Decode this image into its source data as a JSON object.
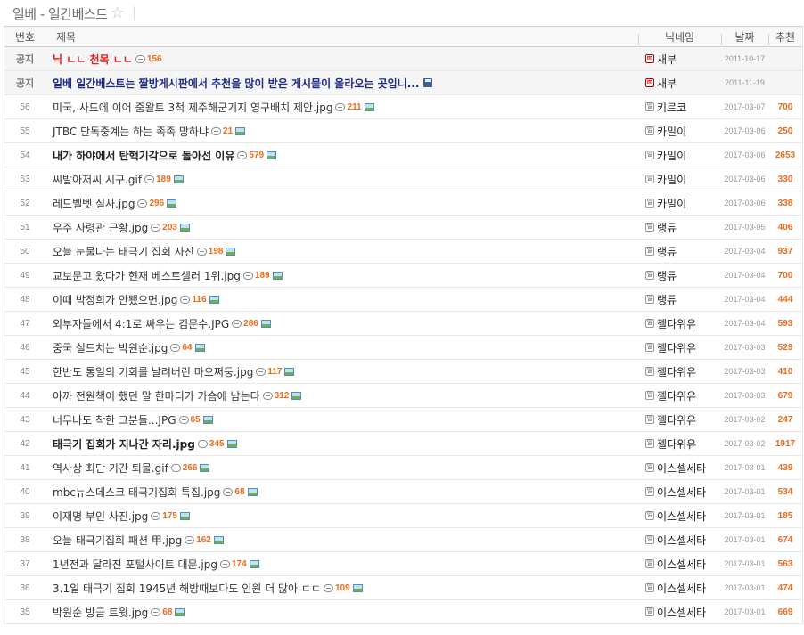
{
  "board": {
    "title": "일베 - 일간베스트",
    "star": "☆"
  },
  "header": {
    "no": "번호",
    "title": "제목",
    "nick": "닉네임",
    "date": "날짜",
    "rec": "추천"
  },
  "notices": [
    {
      "no": "공지",
      "title": "닉 ㄴㄴ 천목 ㄴㄴ",
      "comments": "156",
      "nick": "새부",
      "date": "2011-10-17",
      "rec": ""
    },
    {
      "no": "공지",
      "title": "일베 일간베스트는 짤방게시판에서 추천을 많이 받은 게시물이 올라오는 곳입니...",
      "comments": "",
      "nick": "새부",
      "date": "2011-11-19",
      "rec": ""
    }
  ],
  "rows": [
    {
      "no": "56",
      "title": "미국, 사드에 이어 줌왈트 3척 제주해군기지 영구배치 제안.jpg",
      "comments": "211",
      "nick": "키르코",
      "date": "2017-03-07",
      "rec": "700",
      "bold": false
    },
    {
      "no": "55",
      "title": "JTBC 단독중계는 하는 족족 망하냐",
      "comments": "21",
      "nick": "카밀이",
      "date": "2017-03-06",
      "rec": "250",
      "bold": false
    },
    {
      "no": "54",
      "title": "내가 하야에서 탄핵기각으로 돌아선 이유",
      "comments": "579",
      "nick": "카밀이",
      "date": "2017-03-06",
      "rec": "2653",
      "bold": true
    },
    {
      "no": "53",
      "title": "씨발아저씨 시구.gif",
      "comments": "189",
      "nick": "카밀이",
      "date": "2017-03-06",
      "rec": "330",
      "bold": false
    },
    {
      "no": "52",
      "title": "레드벨벳 실사.jpg",
      "comments": "296",
      "nick": "카밀이",
      "date": "2017-03-06",
      "rec": "338",
      "bold": false
    },
    {
      "no": "51",
      "title": "우주 사령관 근황.jpg",
      "comments": "203",
      "nick": "랭듀",
      "date": "2017-03-05",
      "rec": "406",
      "bold": false
    },
    {
      "no": "50",
      "title": "오늘 눈물나는 태극기 집회 사진",
      "comments": "198",
      "nick": "랭듀",
      "date": "2017-03-04",
      "rec": "937",
      "bold": false
    },
    {
      "no": "49",
      "title": "교보문고 왔다가 현재 베스트셀러 1위.jpg",
      "comments": "189",
      "nick": "랭듀",
      "date": "2017-03-04",
      "rec": "700",
      "bold": false
    },
    {
      "no": "48",
      "title": "이때 박정희가 안됐으면.jpg",
      "comments": "116",
      "nick": "랭듀",
      "date": "2017-03-04",
      "rec": "444",
      "bold": false
    },
    {
      "no": "47",
      "title": "외부자들에서 4:1로 싸우는 김문수.JPG",
      "comments": "286",
      "nick": "젤다위유",
      "date": "2017-03-04",
      "rec": "593",
      "bold": false
    },
    {
      "no": "46",
      "title": "중국 실드치는 박원순.jpg",
      "comments": "64",
      "nick": "젤다위유",
      "date": "2017-03-03",
      "rec": "529",
      "bold": false
    },
    {
      "no": "45",
      "title": "한반도 통일의 기회를 날려버린 마오쩌둥.jpg",
      "comments": "117",
      "nick": "젤다위유",
      "date": "2017-03-03",
      "rec": "410",
      "bold": false
    },
    {
      "no": "44",
      "title": "아까 전원책이 했던 말 한마디가 가슴에 남는다",
      "comments": "312",
      "nick": "젤다위유",
      "date": "2017-03-03",
      "rec": "679",
      "bold": false
    },
    {
      "no": "43",
      "title": "너무나도 착한 그분들...JPG",
      "comments": "65",
      "nick": "젤다위유",
      "date": "2017-03-02",
      "rec": "247",
      "bold": false
    },
    {
      "no": "42",
      "title": "태극기 집회가 지나간 자리.jpg",
      "comments": "345",
      "nick": "젤다위유",
      "date": "2017-03-02",
      "rec": "1917",
      "bold": true
    },
    {
      "no": "41",
      "title": "역사상 최단 기간 퇴물.gif",
      "comments": "266",
      "nick": "이스셀세타",
      "date": "2017-03-01",
      "rec": "439",
      "bold": false
    },
    {
      "no": "40",
      "title": "mbc뉴스데스크 태극기집회 특집.jpg",
      "comments": "68",
      "nick": "이스셀세타",
      "date": "2017-03-01",
      "rec": "534",
      "bold": false
    },
    {
      "no": "39",
      "title": "이재명 부인 사진.jpg",
      "comments": "175",
      "nick": "이스셀세타",
      "date": "2017-03-01",
      "rec": "185",
      "bold": false
    },
    {
      "no": "38",
      "title": "오늘 태극기집회 패션 甲.jpg",
      "comments": "162",
      "nick": "이스셀세타",
      "date": "2017-03-01",
      "rec": "674",
      "bold": false
    },
    {
      "no": "37",
      "title": "1년전과 달라진 포털사이트 대문.jpg",
      "comments": "174",
      "nick": "이스셀세타",
      "date": "2017-03-01",
      "rec": "563",
      "bold": false
    },
    {
      "no": "36",
      "title": "3.1일 태극기 집회 1945년 해방때보다도 인원 더 많아 ㄷㄷ",
      "comments": "109",
      "nick": "이스셀세타",
      "date": "2017-03-01",
      "rec": "474",
      "bold": false
    },
    {
      "no": "35",
      "title": "박원순 방금 트윗.jpg",
      "comments": "68",
      "nick": "이스셀세타",
      "date": "2017-03-01",
      "rec": "669",
      "bold": false
    }
  ]
}
